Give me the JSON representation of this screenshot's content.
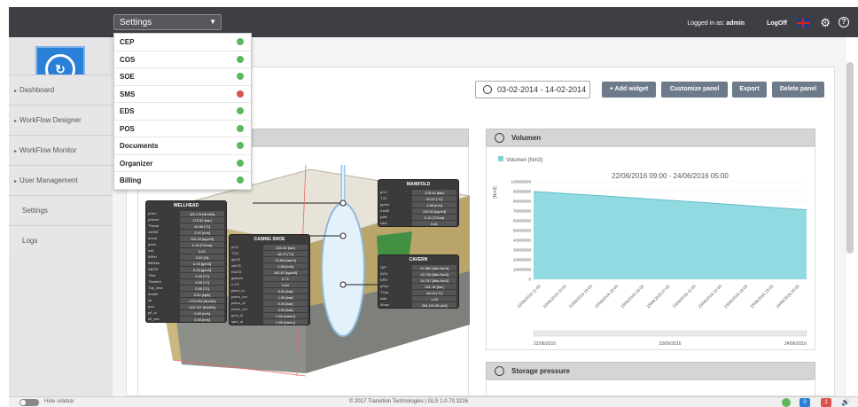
{
  "topbar": {
    "settings_value": "Settings",
    "logged_in_label": "Logged in as:",
    "user": "admin",
    "logoff_label": "LogOff"
  },
  "dropdown": {
    "items": [
      {
        "label": "CEP",
        "status": "#5cb85c"
      },
      {
        "label": "COS",
        "status": "#5cb85c"
      },
      {
        "label": "SOE",
        "status": "#5cb85c"
      },
      {
        "label": "SMS",
        "status": "#d9534f"
      },
      {
        "label": "EDS",
        "status": "#5cb85c"
      },
      {
        "label": "POS",
        "status": "#5cb85c"
      },
      {
        "label": "Documents",
        "status": "#5cb85c"
      },
      {
        "label": "Organizer",
        "status": "#5cb85c"
      },
      {
        "label": "Billing",
        "status": "#5cb85c"
      }
    ]
  },
  "sidebar": {
    "items": [
      {
        "label": "Dashboard",
        "arrow": "▸"
      },
      {
        "label": "WorkFlow Designer",
        "arrow": "▸"
      },
      {
        "label": "WorkFlow Monitor",
        "arrow": "▸"
      },
      {
        "label": "User Management",
        "arrow": "▸"
      },
      {
        "label": "Settings",
        "arrow": ""
      },
      {
        "label": "Logs",
        "arrow": ""
      }
    ]
  },
  "toolbar": {
    "date_range": "03-02-2014 - 14-02-2014",
    "add_widget": "+ Add widget",
    "customize_panel": "Customize panel",
    "export": "Export",
    "delete_panel": "Delete panel"
  },
  "panels": {
    "volumen_title": "Volumen",
    "storage_title": "Storage pressure"
  },
  "wellhead": {
    "title": "WELLHEAD",
    "rows": [
      [
        "pDev",
        "-85.178 [Nm3/h]"
      ],
      [
        "pHead",
        "173.32 [bar]"
      ],
      [
        "THead",
        "44.56 [°C]"
      ],
      [
        "volHM",
        "2.97 [m/s]"
      ],
      [
        "monit",
        "143.20 [kg/m3]"
      ],
      [
        "pchd",
        "0.16 [°C/bar]"
      ],
      [
        "cmt",
        "0.01"
      ],
      [
        "WRel",
        "0.00 [%]"
      ],
      [
        "fillDebs",
        "0.00 [g/m3]"
      ],
      [
        "ABOR",
        "0.00 [g/m3]"
      ],
      [
        "TRel",
        "0.00 [°C]"
      ],
      [
        "TAmient",
        "0.00 [°C]"
      ],
      [
        "Tdp_dew",
        "0.00 [°C]"
      ],
      [
        "rtmain",
        "0.00 [kg/h]"
      ],
      [
        "uir",
        "-173.104 [Nm3/h]"
      ],
      [
        "rpm",
        "223.737 [Nm3/h]"
      ],
      [
        "pfl_ul",
        "0.00 [m/s]"
      ],
      [
        "ufl_sec",
        "0.00 [m/s]"
      ]
    ]
  },
  "casingshoe": {
    "title": "CASING SHOE",
    "rows": [
      [
        "pCS",
        "201.52 [bar]"
      ],
      [
        "TCS",
        "48.72 [°C]"
      ],
      [
        "dpCS",
        "13.55 [bar/m]"
      ],
      [
        "velCS",
        "2.58 [m/s]"
      ],
      [
        "rhoCS",
        "162.87 [kg/m3]"
      ],
      [
        "gasvLb",
        "0.71"
      ],
      [
        "z CS",
        "0.84"
      ],
      [
        "parm_ul",
        "0.00 [bar]"
      ],
      [
        "pzero_um",
        "1.00 [bar]"
      ],
      [
        "pzero_uf",
        "0.00 [bar]"
      ],
      [
        "pzero_um",
        "0.00 [bar]"
      ],
      [
        "ppm_ul",
        "0.00 [bar/m]"
      ],
      [
        "spm_ul",
        "0.00 [bar/m]"
      ]
    ]
  },
  "manifold": {
    "title": "MANIFOLD",
    "rows": [
      [
        "pCC",
        "178.44 [bar]"
      ],
      [
        "TJG",
        "50.07 [°C]"
      ],
      [
        "pprinl",
        "3.86 [m/s]"
      ],
      [
        "rhoMl",
        "133.92 [kg/m3]"
      ],
      [
        "pdel",
        "0.16 [°C/bar]"
      ],
      [
        "zdef",
        "0.81"
      ]
    ]
  },
  "cavern": {
    "title": "CAVERN",
    "rows": [
      [
        "GIP",
        "97.884 [Mio.Nm3]"
      ],
      [
        "AGV",
        "15.728 [Mio.Nm3]"
      ],
      [
        "ERV",
        "14.757 [Mio.Nm3]"
      ],
      [
        "pCav",
        "201.18 [bar]"
      ],
      [
        "TCav",
        "48.18 [°C]"
      ],
      [
        "zlab",
        "1.00"
      ],
      [
        "Wcav",
        "264,141.96 [m3]"
      ]
    ]
  },
  "chart_data": {
    "type": "area",
    "title": "22/06/2016 09:00 - 24/06/2016 05:00",
    "legend": "Volumen [Nm3]",
    "ylabel": "[Nm3]",
    "ylim": [
      0,
      100000000
    ],
    "yticks": [
      "100000000",
      "90000000",
      "80000000",
      "70000000",
      "60000000",
      "50000000",
      "40000000",
      "30000000",
      "20000000",
      "10000000",
      "0"
    ],
    "xticks": [
      "22/06/2016 11:00",
      "22/06/2016 15:00",
      "22/06/2016 19:00",
      "22/06/2016 23:00",
      "23/06/2016 03:00",
      "23/06/2016 07:00",
      "23/06/2016 11:00",
      "23/06/2016 15:00",
      "23/06/2016 19:00",
      "23/06/2016 23:00",
      "24/06/2016 03:00"
    ],
    "navigator_labels": [
      "22/06/2016",
      "23/06/2016",
      "24/06/2016"
    ],
    "series": [
      {
        "name": "Volumen [Nm3]",
        "color": "#7fd3dc",
        "values": [
          90000000,
          88400000,
          86800000,
          85200000,
          83500000,
          81800000,
          80100000,
          78400000,
          76600000,
          74800000,
          73000000,
          71200000
        ]
      }
    ]
  },
  "footer": {
    "hide_sidebar": "Hide sidebar",
    "copyright": "© 2017 Transition Technologies | GLS 1.0.70.3226",
    "badge_blue": "0",
    "badge_red": "1"
  }
}
